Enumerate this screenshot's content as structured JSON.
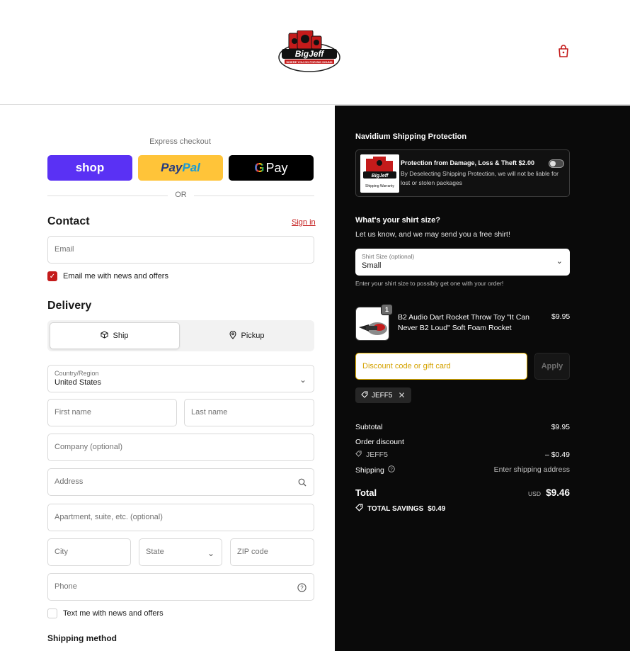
{
  "header": {
    "logo_alt": "BigJeff",
    "logo_text": "BigJeff",
    "logo_tagline": "WHERE YOU GO FOR BIG SOUND",
    "cart_icon": "shopping-bag-icon"
  },
  "express": {
    "title": "Express checkout",
    "shop_label": "shop",
    "paypal_label_1": "Pay",
    "paypal_label_2": "Pal",
    "gpay_g": "G",
    "gpay_label": "Pay",
    "or_label": "OR"
  },
  "contact": {
    "title": "Contact",
    "signin_label": "Sign in",
    "email_placeholder": "Email",
    "news_label": "Email me with news and offers"
  },
  "delivery": {
    "title": "Delivery",
    "ship_label": "Ship",
    "pickup_label": "Pickup",
    "country_label": "Country/Region",
    "country_value": "United States",
    "first_name": "First name",
    "last_name": "Last name",
    "company": "Company (optional)",
    "address": "Address",
    "apartment": "Apartment, suite, etc. (optional)",
    "city": "City",
    "state": "State",
    "zip": "ZIP code",
    "phone": "Phone",
    "text_label": "Text me with news and offers",
    "shipping_method_title": "Shipping method"
  },
  "summary": {
    "protection_title": "Navidium Shipping Protection",
    "protection_heading": "Protection from Damage, Loss & Theft $2.00",
    "protection_desc": "By Deselecting Shipping Protection, we will not be liable for lost or stolen packages",
    "protection_img_caption": "Shipping Warranty",
    "shirt_question": "What's your shirt size?",
    "shirt_sub": "Let us know, and we may send you a free shirt!",
    "shirt_label": "Shirt Size (optional)",
    "shirt_value": "Small",
    "shirt_note": "Enter your shirt size to possibly get one with your order!",
    "product_qty": "1",
    "product_name": "B2 Audio Dart Rocket Throw Toy \"It Can Never B2 Loud\" Soft Foam Rocket",
    "product_price": "$9.95",
    "discount_placeholder": "Discount code or gift card",
    "apply_label": "Apply",
    "applied_code": "JEFF5",
    "subtotal_label": "Subtotal",
    "subtotal_value": "$9.95",
    "order_discount_label": "Order discount",
    "discount_code": "JEFF5",
    "discount_value": "– $0.49",
    "shipping_label": "Shipping",
    "shipping_value": "Enter shipping address",
    "total_label": "Total",
    "currency": "USD",
    "total_value": "$9.46",
    "savings_label": "TOTAL SAVINGS",
    "savings_value": "$0.49"
  },
  "colors": {
    "accent": "#c41b1b",
    "shop": "#5a31f4",
    "paypal": "#ffc439",
    "summary_bg": "#0a0a0a"
  }
}
